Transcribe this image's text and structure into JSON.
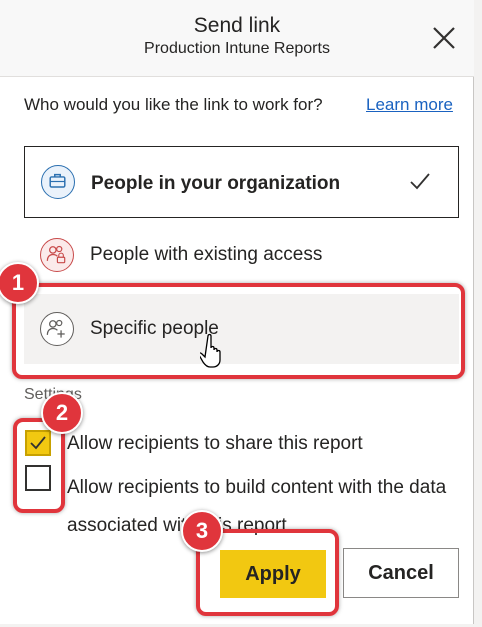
{
  "dialog": {
    "title": "Send link",
    "subtitle": "Production Intune Reports",
    "question": "Who would you like the link to work for?",
    "learn_more": "Learn more"
  },
  "options": [
    {
      "label": "People in your organization",
      "icon": "briefcase-icon",
      "selected": true
    },
    {
      "label": "People with existing access",
      "icon": "people-lock-icon",
      "selected": false
    },
    {
      "label": "Specific people",
      "icon": "people-add-icon",
      "selected": false
    }
  ],
  "settings": {
    "heading": "Settings",
    "items": [
      {
        "label": "Allow recipients to share this report",
        "checked": true
      },
      {
        "label": "Allow recipients to build content with the data associated with this report",
        "checked": false
      }
    ]
  },
  "buttons": {
    "apply": "Apply",
    "cancel": "Cancel"
  },
  "annotations": {
    "step1": "1",
    "step2": "2",
    "step3": "3"
  },
  "colors": {
    "accent": "#f2c811",
    "highlight": "#e0353c",
    "link": "#1a62c0"
  }
}
